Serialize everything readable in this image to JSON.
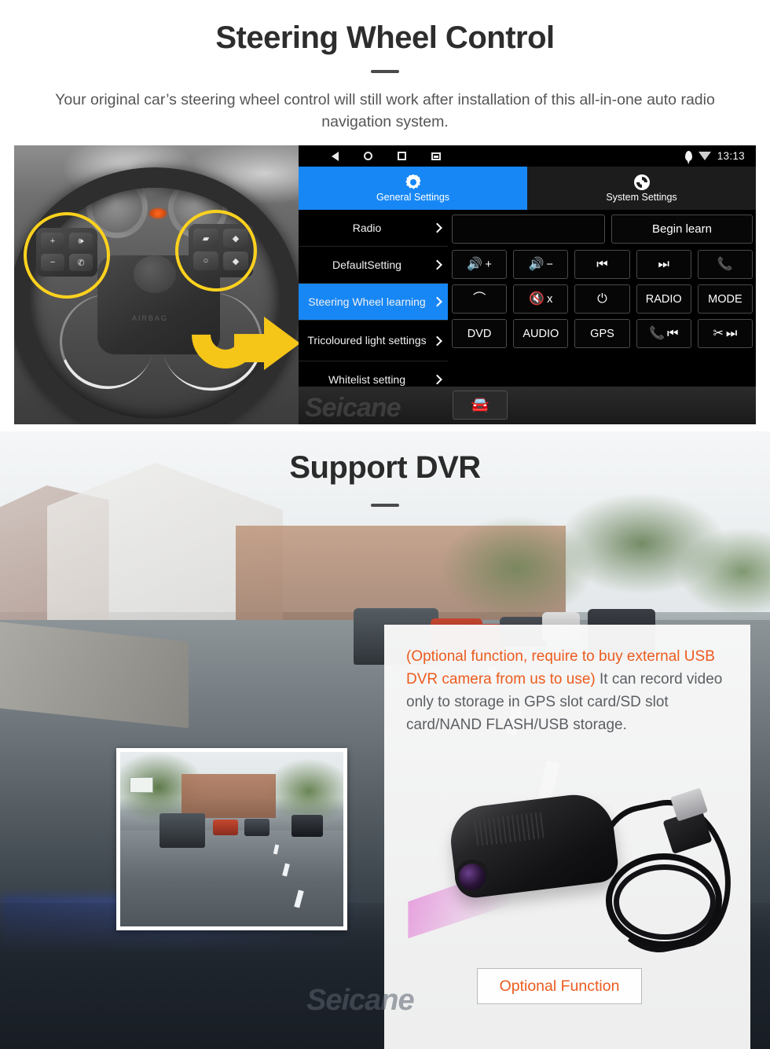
{
  "section1": {
    "title": "Steering Wheel Control",
    "subtitle": "Your original car’s steering wheel control will still work after installation of this all-in-one auto radio navigation system.",
    "photo_name": "steering-wheel-photo"
  },
  "head_unit": {
    "status_bar": {
      "nav": [
        {
          "name": "back-icon",
          "glyph": "◁"
        },
        {
          "name": "home-icon",
          "glyph": "○"
        },
        {
          "name": "recents-icon",
          "glyph": "□"
        },
        {
          "name": "screenshot-icon",
          "glyph": "▣"
        }
      ],
      "location_icon": "location-pin-icon",
      "wifi_icon": "wifi-icon",
      "clock": "13:13"
    },
    "tabs": [
      {
        "label": "General Settings",
        "icon": "gear-icon",
        "active": true
      },
      {
        "label": "System Settings",
        "icon": "system-settings-icon",
        "active": false
      }
    ],
    "menu": [
      {
        "label": "Radio",
        "selected": false
      },
      {
        "label": "DefaultSetting",
        "selected": false
      },
      {
        "label": "Steering Wheel learning",
        "selected": true
      },
      {
        "label": "Tricoloured light settings",
        "selected": false
      },
      {
        "label": "Whitelist setting",
        "selected": false
      }
    ],
    "learn_input_value": "",
    "learn_input_placeholder": "",
    "begin_learn_label": "Begin learn",
    "keys": [
      {
        "label": "+",
        "icon": "volume-up-icon"
      },
      {
        "label": "−",
        "icon": "volume-down-icon"
      },
      {
        "label": "",
        "icon": "previous-track-icon"
      },
      {
        "label": "",
        "icon": "next-track-icon"
      },
      {
        "label": "",
        "icon": "phone-answer-icon"
      },
      {
        "label": "",
        "icon": "phone-hangup-icon"
      },
      {
        "label": "x",
        "icon": "volume-mute-icon"
      },
      {
        "label": "",
        "icon": "power-icon"
      },
      {
        "label": "RADIO",
        "icon": ""
      },
      {
        "label": "MODE",
        "icon": ""
      },
      {
        "label": "DVD",
        "icon": ""
      },
      {
        "label": "AUDIO",
        "icon": ""
      },
      {
        "label": "GPS",
        "icon": ""
      },
      {
        "label": "",
        "icon": "phone-previous-icon"
      },
      {
        "label": "",
        "icon": "phone-reject-next-icon"
      }
    ],
    "footer_button_icon": "car-settings-icon",
    "watermark": "Seicane",
    "accent_color": "#1787f5"
  },
  "section2": {
    "title": "Support DVR",
    "panel": {
      "warning_text": "(Optional function, require to buy external USB DVR camera from us to use)",
      "body_text": "It can record video only to storage in GPS slot card/SD slot card/NAND FLASH/USB storage.",
      "warning_color": "#ec5b1e",
      "device_name": "usb-dvr-camera",
      "optional_button_label": "Optional Function"
    },
    "inset_name": "dvr-sample-video",
    "watermark": "Seicane"
  }
}
